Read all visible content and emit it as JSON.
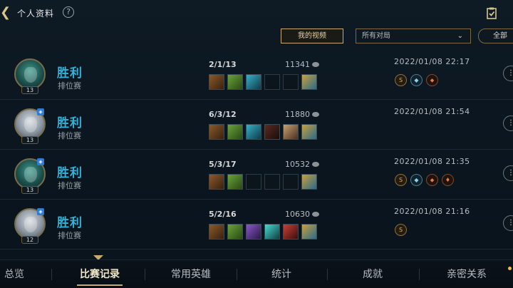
{
  "header": {
    "title": "个人资料",
    "help": "?",
    "back": "❮"
  },
  "toolbar": {
    "video_label": "我的视频",
    "filter_value": "所有对局",
    "filter_chevron": "⌄",
    "all_label": "全部"
  },
  "matches": [
    {
      "result": "胜利",
      "mode": "排位赛",
      "level": "13",
      "party": false,
      "avatar": "green",
      "kda": "2/1/13",
      "gold": "11341",
      "datetime": "2022/01/08 22:17",
      "items": [
        "brown",
        "green",
        "teal",
        "empty",
        "empty",
        "boot"
      ],
      "badges": [
        "S",
        "◆",
        "⬥"
      ]
    },
    {
      "result": "胜利",
      "mode": "排位赛",
      "level": "13",
      "party": true,
      "avatar": "knight",
      "kda": "6/3/12",
      "gold": "11880",
      "datetime": "2022/01/08 21:54",
      "items": [
        "brown",
        "green",
        "teal",
        "dark",
        "tan",
        "boot"
      ],
      "badges": []
    },
    {
      "result": "胜利",
      "mode": "排位赛",
      "level": "13",
      "party": true,
      "avatar": "green",
      "kda": "5/3/17",
      "gold": "10532",
      "datetime": "2022/01/08 21:35",
      "items": [
        "brown",
        "green",
        "empty",
        "empty",
        "empty",
        "boot"
      ],
      "badges": [
        "S",
        "◆",
        "⬥",
        "♦"
      ]
    },
    {
      "result": "胜利",
      "mode": "排位赛",
      "level": "12",
      "party": true,
      "avatar": "knight",
      "kda": "5/2/16",
      "gold": "10630",
      "datetime": "2022/01/08 21:16",
      "items": [
        "brown",
        "green",
        "purple",
        "cyan",
        "red",
        "boot"
      ],
      "badges": [
        "S"
      ]
    }
  ],
  "tabs": [
    {
      "label": "总览",
      "active": false
    },
    {
      "label": "比赛记录",
      "active": true
    },
    {
      "label": "常用英雄",
      "active": false
    },
    {
      "label": "统计",
      "active": false
    },
    {
      "label": "成就",
      "active": false
    },
    {
      "label": "亲密关系",
      "active": false
    }
  ],
  "more_label": "⋮"
}
